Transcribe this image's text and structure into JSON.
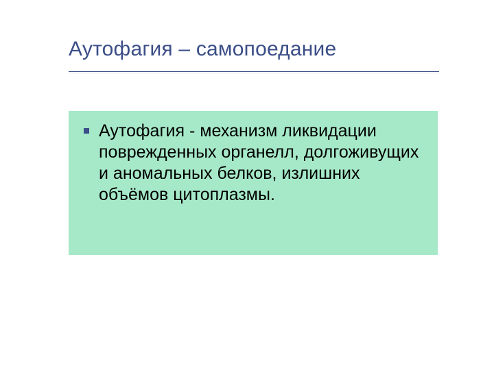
{
  "slide": {
    "title": "Аутофагия –  самопоедание",
    "body": "Аутофагия - механизм ликвидации поврежденных органелл, долгоживущих и аномальных белков, излишних объёмов цитоплазмы.",
    "colors": {
      "title": "#3B4E87",
      "bullet": "#3B4E87",
      "highlight_bg": "#A6E9C8"
    }
  }
}
